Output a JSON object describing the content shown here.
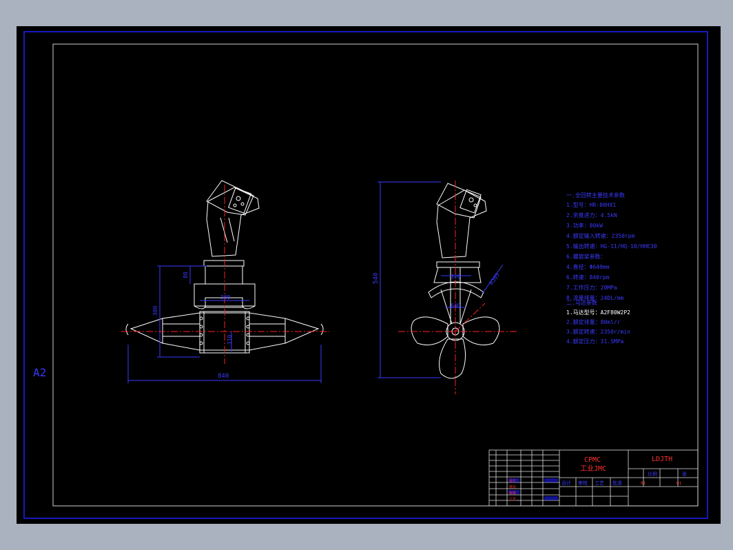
{
  "sheet": {
    "size_label": "A2"
  },
  "left_view": {
    "dims": {
      "d80": "80",
      "d380": "380",
      "d380b": "380",
      "d110": "110",
      "d840": "840"
    }
  },
  "right_view": {
    "dims": {
      "d540": "540",
      "d320": "320",
      "d640": "640",
      "r305": "R305"
    }
  },
  "notes": {
    "heading": "一.全回转主要技术参数",
    "items": [
      "1.型号：HR-80HX1",
      "2.余推进力：4.5kN",
      "3.功率：80kW",
      "4.额定输入转速：2350rpm",
      "5.输出转速：HG-11/HQ-10/HHE30",
      "6.螺旋桨参数：",
      "  4.直径：Φ640mm",
      "  6.转速：840rpm",
      "7.工作压力：20MPa",
      "8.流量排量：24DL/mm"
    ],
    "sub_heading": "二.马达参数",
    "sub_items": [
      "1.马达型号：A2F80W2P2",
      "2.额定排量：80ml/r",
      "3.额定转速：2350r/min",
      "4.额定压力：31.5MPa"
    ]
  },
  "title_block": {
    "company_line1": "CPMC",
    "company_line2": "工业JMC",
    "drawing_name": "LDJTH",
    "scale_label": "比例",
    "sheet_label": "张",
    "row_a": "01",
    "row_b": "01",
    "sig_labels": [
      "设计",
      "审核",
      "工艺",
      "批准"
    ],
    "small_red": [
      "设计",
      "校对",
      "审核",
      "工艺"
    ]
  },
  "colors": {
    "background": "#000000",
    "frame": "#2020ff",
    "geometry": "#ffffff",
    "centerline": "#ff2020",
    "dimension": "#3a3aff"
  }
}
